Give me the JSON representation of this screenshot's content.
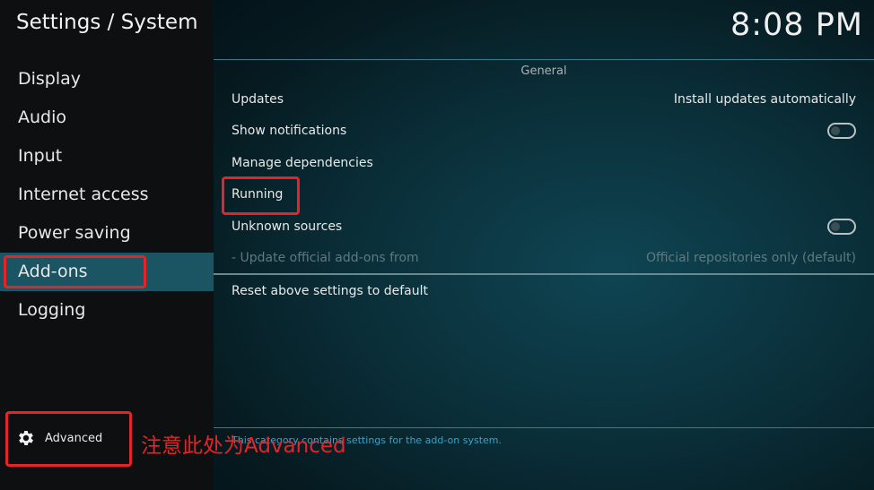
{
  "header": {
    "title": "Settings / System",
    "clock": "8:08 PM"
  },
  "sidebar": {
    "items": [
      {
        "label": "Display"
      },
      {
        "label": "Audio"
      },
      {
        "label": "Input"
      },
      {
        "label": "Internet access"
      },
      {
        "label": "Power saving"
      },
      {
        "label": "Add-ons",
        "active": true
      },
      {
        "label": "Logging"
      }
    ],
    "advanced_label": "Advanced",
    "advanced_icon": "gear-icon"
  },
  "main": {
    "section_title": "General",
    "rows": {
      "updates": {
        "label": "Updates",
        "value": "Install updates automatically"
      },
      "show_notifications": {
        "label": "Show notifications",
        "toggle": "off"
      },
      "manage_dependencies": {
        "label": "Manage dependencies"
      },
      "running": {
        "label": "Running"
      },
      "unknown_sources": {
        "label": "Unknown sources",
        "toggle": "off"
      },
      "update_official": {
        "label": "- Update official add-ons from",
        "value": "Official repositories only (default)",
        "disabled": true
      },
      "reset": {
        "label": "Reset above settings to default"
      }
    },
    "help_text": "This category contains settings for the add-on system."
  },
  "annotation": {
    "note": "注意此处为Advanced",
    "color": "#e5242a"
  },
  "colors": {
    "active_item_bg": "#1b5563",
    "accent_line": "#2f7f92",
    "help_text": "#3aa2c9"
  }
}
